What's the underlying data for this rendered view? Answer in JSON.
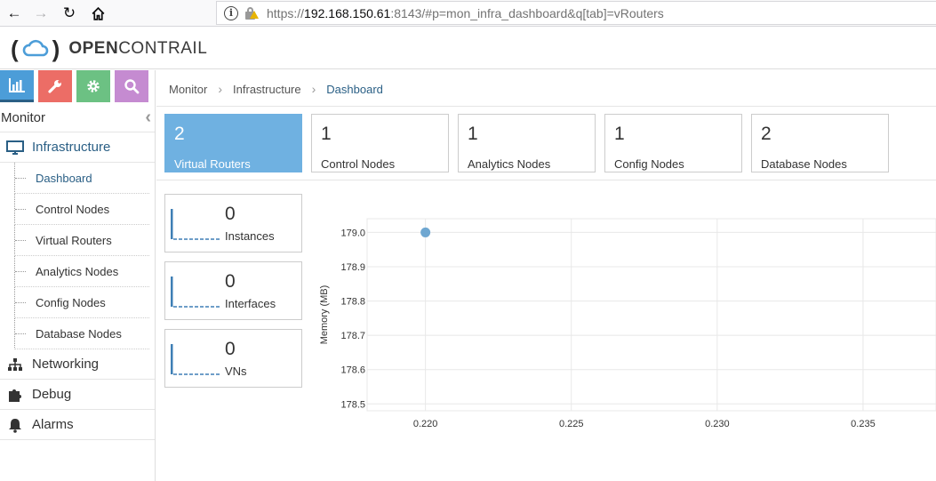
{
  "browser": {
    "url_prefix": "https://",
    "url_host": "192.168.150.61",
    "url_rest": ":8143/#p=mon_infra_dashboard&q[tab]=vRouters",
    "icons": [
      "back-icon",
      "forward-icon",
      "reload-icon",
      "home-icon",
      "info-icon",
      "insecure-lock-icon"
    ]
  },
  "app": {
    "logo_left": "(",
    "logo_right": ")",
    "logo_bold": "OPEN",
    "logo_rest": "CONTRAIL"
  },
  "sidebar": {
    "tabs": [
      {
        "name": "monitor",
        "icon": "bar-chart-icon",
        "color": "#4c9dd8"
      },
      {
        "name": "configure",
        "icon": "wrench-icon",
        "color": "#ec6d66"
      },
      {
        "name": "settings",
        "icon": "gear-icon",
        "color": "#6cc183"
      },
      {
        "name": "query",
        "icon": "search-icon",
        "color": "#c58bd1"
      }
    ],
    "section_title": "Monitor",
    "groups": [
      {
        "label": "Infrastructure",
        "icon": "monitor-icon"
      },
      {
        "label": "Networking",
        "icon": "network-icon"
      },
      {
        "label": "Debug",
        "icon": "puzzle-icon"
      },
      {
        "label": "Alarms",
        "icon": "bell-icon"
      }
    ],
    "infra_items": [
      "Dashboard",
      "Control Nodes",
      "Virtual Routers",
      "Analytics Nodes",
      "Config Nodes",
      "Database Nodes"
    ]
  },
  "breadcrumb": [
    "Monitor",
    "Infrastructure",
    "Dashboard"
  ],
  "tiles": [
    {
      "value": "2",
      "label": "Virtual Routers"
    },
    {
      "value": "1",
      "label": "Control Nodes"
    },
    {
      "value": "1",
      "label": "Analytics Nodes"
    },
    {
      "value": "1",
      "label": "Config Nodes"
    },
    {
      "value": "2",
      "label": "Database Nodes"
    }
  ],
  "spark_tiles": [
    {
      "value": "0",
      "label": "Instances"
    },
    {
      "value": "0",
      "label": "Interfaces"
    },
    {
      "value": "0",
      "label": "VNs"
    }
  ],
  "accent_color": "#2a5f85",
  "active_tile_color": "#6fb1e1",
  "chart_data": {
    "type": "scatter",
    "xlabel": "",
    "ylabel": "Memory (MB)",
    "x_ticks": [
      "0.220",
      "0.225",
      "0.230",
      "0.235"
    ],
    "y_ticks": [
      "178.5",
      "178.6",
      "178.7",
      "178.8",
      "178.9",
      "179.0"
    ],
    "xlim": [
      0.218,
      0.2375
    ],
    "ylim": [
      178.48,
      179.04
    ],
    "points": [
      {
        "x": 0.22,
        "y": 179.0
      }
    ],
    "point_color": "#6fa7d1",
    "grid": true
  }
}
